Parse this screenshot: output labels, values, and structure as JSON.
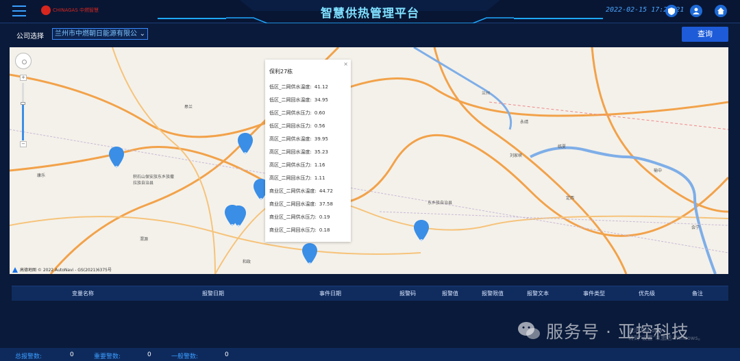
{
  "header": {
    "title": "智慧供热管理平台",
    "datetime": "2022-02-15 17:21:21",
    "logo_text": "CHINAGAS 中燃智慧",
    "colors": {
      "background": "#081634",
      "title": "#7fe0ff",
      "accent": "#1fa8ff",
      "icon_bg": "#1e6ad6"
    },
    "icons": [
      "menu-icon",
      "shield-icon",
      "user-icon",
      "home-icon"
    ]
  },
  "toolbar": {
    "company_label": "公司选择",
    "company_value": "兰州市中燃朝日能源有限公",
    "query_label": "查询"
  },
  "map": {
    "labels": [
      "皋兰",
      "兰州",
      "永靖",
      "临夏",
      "刘家峡",
      "榆中",
      "定西",
      "会宁",
      "东乡族自治县",
      "积石山保安族东乡族撒拉族自治县",
      "康乐",
      "渭源",
      "和政",
      "广河",
      "临洮",
      "陇西",
      "漳县",
      "通渭",
      "静宁",
      "秦安"
    ],
    "copyright": "高德地图  © 2022 AutoNavi - GS(2021)6375号",
    "marker_count": 7
  },
  "popup": {
    "title": "保利27栋",
    "close": "×",
    "rows": [
      {
        "label": "低区_二网供水温度:",
        "value": "41.12"
      },
      {
        "label": "低区_二网回水温度:",
        "value": "34.95"
      },
      {
        "label": "低区_二网供水压力:",
        "value": "0.60"
      },
      {
        "label": "低区_二网回水压力:",
        "value": "0.56"
      },
      {
        "label": "高区_二网供水温度:",
        "value": "39.95"
      },
      {
        "label": "高区_二网回水温度:",
        "value": "35.23"
      },
      {
        "label": "高区_二网供水压力:",
        "value": "1.16"
      },
      {
        "label": "高区_二网回水压力:",
        "value": "1.11"
      },
      {
        "label": "商业区_二网供水温度:",
        "value": "44.72"
      },
      {
        "label": "商业区_二网回水温度:",
        "value": "37.58"
      },
      {
        "label": "商业区_二网供水压力:",
        "value": "0.19"
      },
      {
        "label": "商业区_二网回水压力:",
        "value": "0.18"
      }
    ]
  },
  "table": {
    "columns": [
      "变量名称",
      "报警日期",
      "事件日期",
      "报警码",
      "报警值",
      "报警限值",
      "报警文本",
      "事件类型",
      "优先级",
      "备注"
    ]
  },
  "watermark": {
    "text": "服务号 · 亚控科技",
    "activate_line1": "激活 Windows",
    "activate_line2": "转到\"设置\"以激活 Windows。"
  },
  "footer": {
    "total_label": "总报警数:",
    "total_value": "0",
    "important_label": "重要警数:",
    "important_value": "0",
    "normal_label": "一般警数:",
    "normal_value": "0"
  }
}
